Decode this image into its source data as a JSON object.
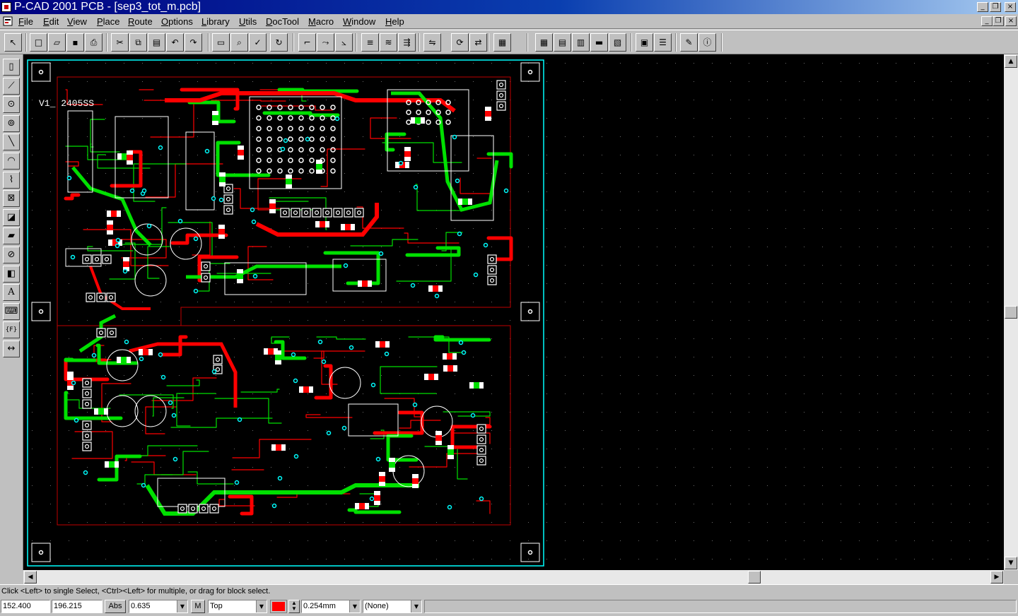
{
  "window": {
    "title": "P-CAD 2001 PCB - [sep3_tot_m.pcb]",
    "min_glyph": "_",
    "restore_glyph": "❐",
    "close_glyph": "×"
  },
  "menu": [
    {
      "label": "File"
    },
    {
      "label": "Edit"
    },
    {
      "label": "View"
    },
    {
      "label": "Place"
    },
    {
      "label": "Route"
    },
    {
      "label": "Options"
    },
    {
      "label": "Library"
    },
    {
      "label": "Utils"
    },
    {
      "label": "DocTool"
    },
    {
      "label": "Macro"
    },
    {
      "label": "Window"
    },
    {
      "label": "Help"
    }
  ],
  "toolbar": {
    "icons": [
      "select-icon",
      "new-icon",
      "open-icon",
      "save-icon",
      "print-icon",
      "cut-icon",
      "copy-icon",
      "paste-icon",
      "undo-icon",
      "redo-icon",
      "zoom-window-icon",
      "zoom-icon",
      "drc-icon",
      "redraw-icon",
      "route-icon",
      "manual-route-icon",
      "miter-icon",
      "bus-icon",
      "layer-icon",
      "fanout-icon",
      "flip-icon",
      "rotate-icon",
      "mirror-icon",
      "library-icon",
      "table-icon",
      "pattern-icon",
      "component-icon",
      "netlist-icon",
      "report-icon",
      "via-icon",
      "layers-list-icon",
      "edit-icon",
      "info-icon"
    ]
  },
  "left_tools": [
    "place-component-icon",
    "place-connection-icon",
    "place-pad-icon",
    "place-via-icon",
    "place-line-icon",
    "place-arc-icon",
    "place-polygon-icon",
    "place-copper-pour-icon",
    "place-cutout-icon",
    "place-plane-icon",
    "place-keepout-icon",
    "place-room-icon",
    "place-text-icon",
    "place-attribute-icon",
    "place-field-icon",
    "place-dimension-icon"
  ],
  "board": {
    "label_top": "V1_ 2405SS",
    "colors": {
      "top": "#ff0000",
      "bottom": "#00e000",
      "board": "#00ffff",
      "silk": "#ffffff",
      "pad": "#ffffff",
      "via": "#00ffff"
    }
  },
  "status": {
    "hint": "Click <Left> to single Select, <Ctrl><Left> for multiple, or drag for block select.",
    "x": "152.400",
    "y": "196.215",
    "abs": "Abs",
    "grid": "0.635",
    "m": "M",
    "layer": "Top",
    "line_width": "0.254mm",
    "net": "(None)",
    "layer_color": "#ff0000"
  }
}
